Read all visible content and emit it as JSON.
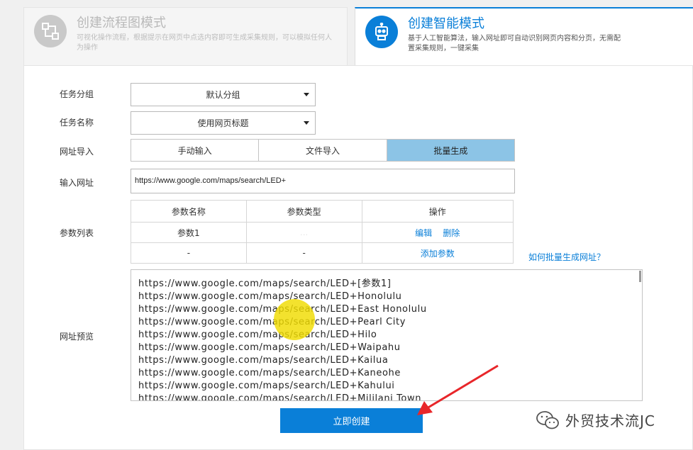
{
  "modes": {
    "flowchart": {
      "title": "创建流程图模式",
      "desc": "可视化操作流程，根据提示在网页中点选内容即可生成采集规则，可以模拟任何人为操作",
      "icon": "flowchart-icon"
    },
    "smart": {
      "title": "创建智能模式",
      "desc": "基于人工智能算法，输入网址即可自动识别网页内容和分页，无需配置采集规则，一键采集",
      "icon": "robot-icon"
    }
  },
  "form": {
    "task_group_label": "任务分组",
    "task_group_value": "默认分组",
    "task_name_label": "任务名称",
    "task_name_value": "使用网页标题",
    "url_import_label": "网址导入",
    "url_import_options": [
      "手动输入",
      "文件导入",
      "批量生成"
    ],
    "url_import_selected": "批量生成",
    "input_url_label": "输入网址",
    "input_url_value": "https://www.google.com/maps/search/LED+",
    "param_list_label": "参数列表",
    "param_table": {
      "headers": [
        "参数名称",
        "参数类型",
        "操作"
      ],
      "rows": [
        {
          "name": "参数1",
          "type": "...",
          "edit": "编辑",
          "delete": "删除"
        },
        {
          "name": "-",
          "type": "-",
          "action": "添加参数"
        }
      ]
    },
    "help_link": "如何批量生成网址？",
    "preview_label": "网址预览",
    "preview_lines": [
      "https://www.google.com/maps/search/LED+[参数1]",
      "https://www.google.com/maps/search/LED+Honolulu",
      "https://www.google.com/maps/search/LED+East Honolulu",
      "https://www.google.com/maps/search/LED+Pearl City",
      "https://www.google.com/maps/search/LED+Hilo",
      "https://www.google.com/maps/search/LED+Waipahu",
      "https://www.google.com/maps/search/LED+Kailua",
      "https://www.google.com/maps/search/LED+Kaneohe",
      "https://www.google.com/maps/search/LED+Kahului",
      "https://www.google.com/maps/search/LED+Mililani Town"
    ],
    "submit_label": "立即创建"
  },
  "watermark": {
    "text": "外贸技术流JC",
    "icon": "wechat-icon"
  },
  "colors": {
    "accent": "#0a7fd8",
    "selected_tab": "#8cc4e6",
    "cursor_highlight": "#f0dc00",
    "annotation_arrow": "#e8262a"
  }
}
